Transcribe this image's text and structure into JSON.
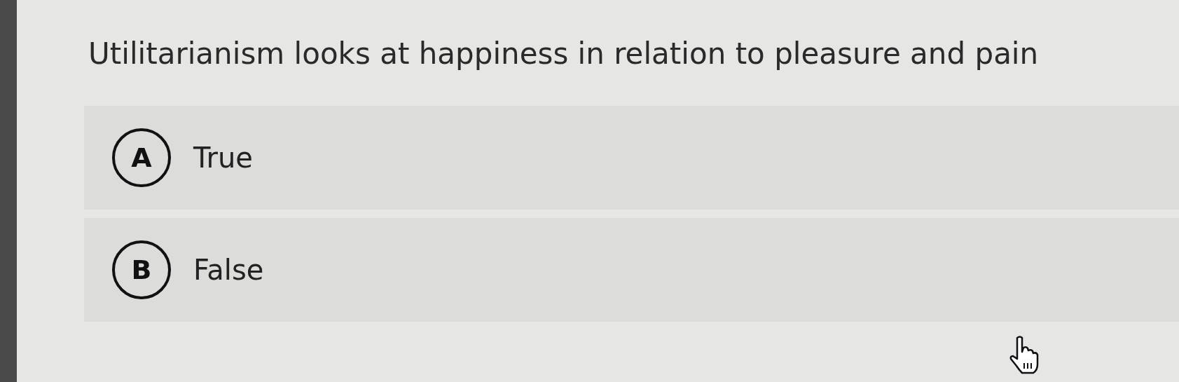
{
  "question": "Utilitarianism looks at happiness in relation to pleasure and pain",
  "options": [
    {
      "letter": "A",
      "text": "True"
    },
    {
      "letter": "B",
      "text": "False"
    }
  ]
}
